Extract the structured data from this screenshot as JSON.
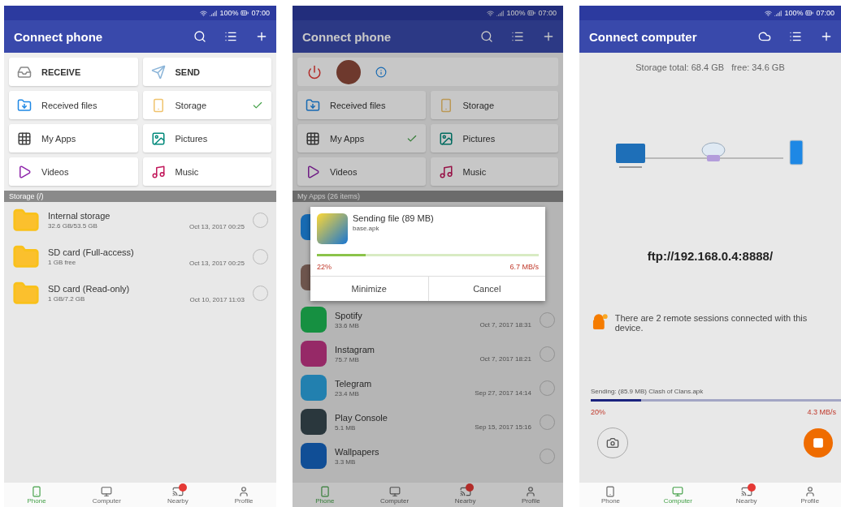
{
  "screens": [
    {
      "kind": "home",
      "status_bar": {
        "battery": "100%",
        "time": "07:00"
      },
      "title": "Connect phone",
      "tiles": [
        {
          "kind": "receive",
          "label": "RECEIVE",
          "checked": false
        },
        {
          "kind": "send",
          "label": "SEND",
          "checked": false
        },
        {
          "kind": "files",
          "label": "Received files",
          "checked": false
        },
        {
          "kind": "storage",
          "label": "Storage",
          "checked": true
        },
        {
          "kind": "apps",
          "label": "My Apps",
          "checked": false
        },
        {
          "kind": "pictures",
          "label": "Pictures",
          "checked": false
        },
        {
          "kind": "videos",
          "label": "Videos",
          "checked": false
        },
        {
          "kind": "music",
          "label": "Music",
          "checked": false
        }
      ],
      "section": "Storage (/)",
      "rows": [
        {
          "kind": "folder",
          "name": "Internal storage",
          "detail": "32.6 GB/53.5 GB",
          "date": "Oct 13, 2017 00:25",
          "checked": false
        },
        {
          "kind": "folder",
          "name": "SD card (Full-access)",
          "detail": "1 GB free",
          "date": "Oct 13, 2017 00:25",
          "checked": false
        },
        {
          "kind": "folder",
          "name": "SD card (Read-only)",
          "detail": "1 GB/7.2 GB",
          "date": "Oct 10, 2017 11:03",
          "checked": false
        }
      ],
      "tabs": [
        {
          "label": "Phone",
          "selected": true,
          "badge": false
        },
        {
          "label": "Computer",
          "selected": false,
          "badge": false
        },
        {
          "label": "Nearby",
          "selected": false,
          "badge": true
        },
        {
          "label": "Profile",
          "selected": false,
          "badge": false
        }
      ]
    },
    {
      "kind": "apps",
      "status_bar": {
        "battery": "100%",
        "time": "07:00"
      },
      "title": "Connect phone",
      "tiles": [
        {
          "kind": "files",
          "label": "Received files",
          "checked": false
        },
        {
          "kind": "storage",
          "label": "Storage",
          "checked": false
        },
        {
          "kind": "apps",
          "label": "My Apps",
          "checked": true
        },
        {
          "kind": "pictures",
          "label": "Pictures",
          "checked": false
        },
        {
          "kind": "videos",
          "label": "Videos",
          "checked": false
        },
        {
          "kind": "music",
          "label": "Music",
          "checked": false
        }
      ],
      "section": "My Apps (26 items)",
      "rows": [
        {
          "kind": "hidden"
        },
        {
          "kind": "hidden"
        },
        {
          "kind": "app",
          "name": "Spotify",
          "detail": "33.6 MB",
          "date": "Oct 7, 2017 18:31",
          "checked": false
        },
        {
          "kind": "app",
          "name": "Instagram",
          "detail": "75.7 MB",
          "date": "Oct 7, 2017 18:21",
          "checked": false
        },
        {
          "kind": "app",
          "name": "Telegram",
          "detail": "23.4 MB",
          "date": "Sep 27, 2017 14:14",
          "checked": false
        },
        {
          "kind": "app",
          "name": "Play Console",
          "detail": "5.1 MB",
          "date": "Sep 15, 2017 15:16",
          "checked": false
        },
        {
          "kind": "app",
          "name": "Wallpapers",
          "detail": "3.3 MB",
          "checked": false
        }
      ],
      "dialog": {
        "title": "Sending file (89 MB)",
        "file": "base.apk",
        "level": 0.22,
        "percent": "22%",
        "speed": "6.7 MB/s",
        "buttons": [
          "Minimize",
          "Cancel"
        ]
      },
      "tabs": [
        {
          "label": "Phone",
          "selected": true,
          "badge": false
        },
        {
          "label": "Computer",
          "selected": false,
          "badge": false
        },
        {
          "label": "Nearby",
          "selected": false,
          "badge": true
        },
        {
          "label": "Profile",
          "selected": false,
          "badge": false
        }
      ]
    },
    {
      "kind": "computer",
      "status_bar": {
        "battery": "100%",
        "time": "07:00"
      },
      "title": "Connect computer",
      "storage_total": "Storage total: 68.4 GB",
      "storage_free": "free: 34.6 GB",
      "address": "ftp://192.168.0.4:8888/",
      "sessions": "There are 2 remote sessions connected with this device.",
      "transfer": {
        "label": "Sending: (85.9 MB) Clash of Clans.apk",
        "level": 0.2,
        "percent": "20%",
        "speed": "4.3 MB/s"
      },
      "tabs": [
        {
          "label": "Phone",
          "selected": false,
          "badge": false
        },
        {
          "label": "Computer",
          "selected": true,
          "badge": false
        },
        {
          "label": "Nearby",
          "selected": false,
          "badge": true
        },
        {
          "label": "Profile",
          "selected": false,
          "badge": false
        }
      ]
    }
  ]
}
